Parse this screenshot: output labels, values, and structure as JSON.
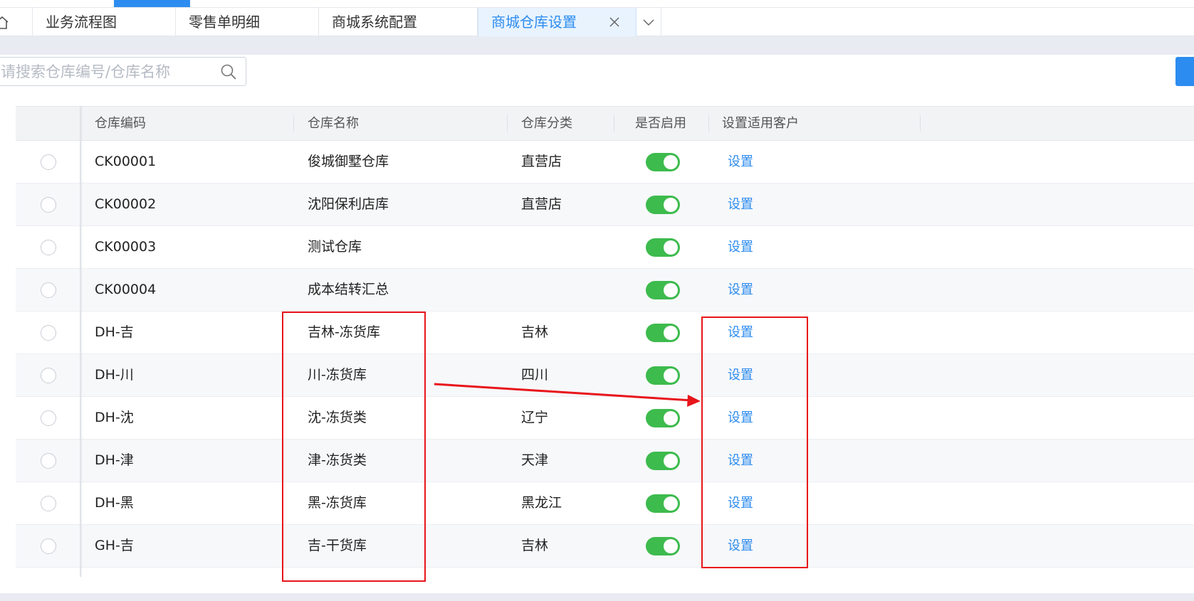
{
  "tabs": {
    "home_icon": "home-icon",
    "items": [
      {
        "label": "业务流程图"
      },
      {
        "label": "零售单明细"
      },
      {
        "label": "商城系统配置"
      },
      {
        "label": "商城仓库设置",
        "active": true
      }
    ],
    "close_icon": "close-icon",
    "more_icon": "chevron-down-icon",
    "accent_color": "#2d8cf0"
  },
  "search": {
    "placeholder": "请搜索仓库编号/仓库名称",
    "value": "",
    "icon": "search-icon"
  },
  "table": {
    "headers": {
      "code": "仓库编码",
      "name": "仓库名称",
      "type": "仓库分类",
      "enabled": "是否启用",
      "customer": "设置适用客户"
    },
    "rows": [
      {
        "code": "CK00001",
        "name": "俊城御墅仓库",
        "type": "直营店",
        "enabled": true,
        "action": "设置"
      },
      {
        "code": "CK00002",
        "name": "沈阳保利店库",
        "type": "直营店",
        "enabled": true,
        "action": "设置"
      },
      {
        "code": "CK00003",
        "name": "测试仓库",
        "type": "",
        "enabled": true,
        "action": "设置"
      },
      {
        "code": "CK00004",
        "name": "成本结转汇总",
        "type": "",
        "enabled": true,
        "action": "设置"
      },
      {
        "code": "DH-吉",
        "name": "吉林-冻货库",
        "type": "吉林",
        "enabled": true,
        "action": "设置"
      },
      {
        "code": "DH-川",
        "name": "川-冻货库",
        "type": "四川",
        "enabled": true,
        "action": "设置"
      },
      {
        "code": "DH-沈",
        "name": "沈-冻货类",
        "type": "辽宁",
        "enabled": true,
        "action": "设置"
      },
      {
        "code": "DH-津",
        "name": "津-冻货类",
        "type": "天津",
        "enabled": true,
        "action": "设置"
      },
      {
        "code": "DH-黑",
        "name": "黑-冻货库",
        "type": "黑龙江",
        "enabled": true,
        "action": "设置"
      },
      {
        "code": "GH-吉",
        "name": "吉-干货库",
        "type": "吉林",
        "enabled": true,
        "action": "设置"
      }
    ],
    "toggle_on_color": "#3dbb4d",
    "link_color": "#2d8cf0"
  },
  "annotation_color": "#e8151b"
}
